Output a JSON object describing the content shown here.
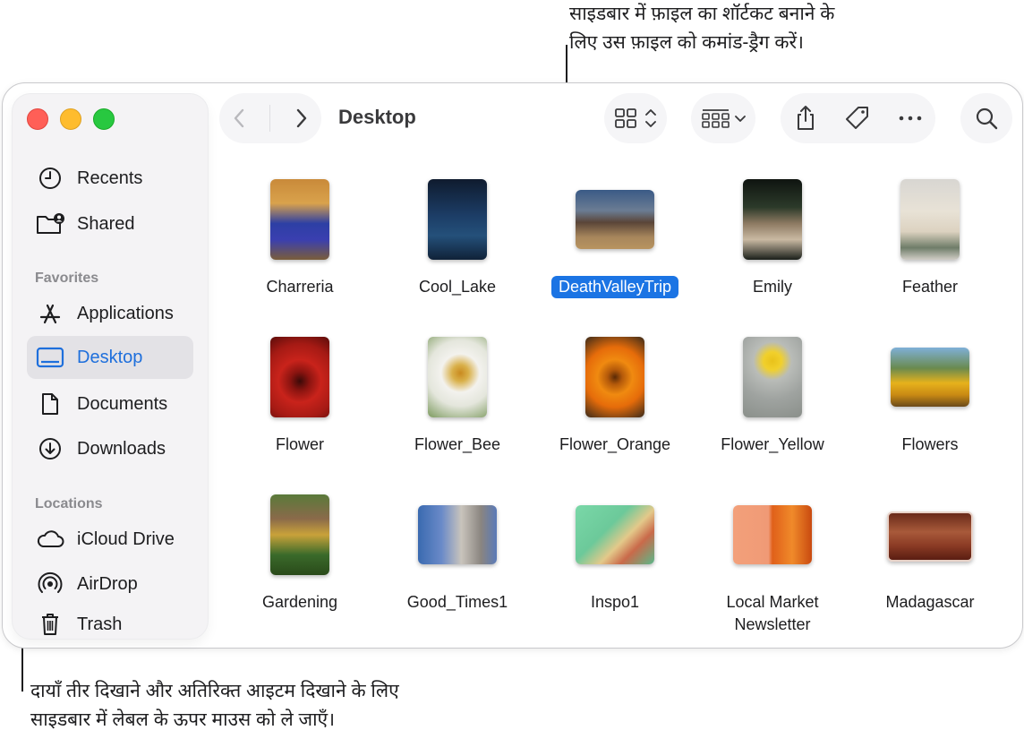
{
  "callouts": {
    "top": [
      "साइडबार में फ़ाइल का शॉर्टकट बनाने के",
      "लिए उस फ़ाइल को कमांड-ड्रैग करें।"
    ],
    "bottom": [
      "दायाँ तीर दिखाने और अतिरिक्त आइटम दिखाने के लिए",
      "साइडबार में लेबल के ऊपर माउस को ले जाएँ।"
    ]
  },
  "window": {
    "title": "Desktop"
  },
  "sidebar": {
    "items_top": [
      {
        "label": "Recents",
        "icon": "clock-icon"
      },
      {
        "label": "Shared",
        "icon": "shared-folder-icon"
      }
    ],
    "favorites_heading": "Favorites",
    "favorites": [
      {
        "label": "Applications",
        "icon": "applications-icon"
      },
      {
        "label": "Desktop",
        "icon": "desktop-icon",
        "selected": true
      },
      {
        "label": "Documents",
        "icon": "document-icon"
      },
      {
        "label": "Downloads",
        "icon": "download-icon"
      }
    ],
    "locations_heading": "Locations",
    "locations": [
      {
        "label": "iCloud Drive",
        "icon": "cloud-icon"
      },
      {
        "label": "AirDrop",
        "icon": "airdrop-icon"
      },
      {
        "label": "Trash",
        "icon": "trash-icon"
      }
    ]
  },
  "files": [
    {
      "name": "Charreria"
    },
    {
      "name": "Cool_Lake"
    },
    {
      "name": "DeathValleyTrip",
      "selected": true
    },
    {
      "name": "Emily"
    },
    {
      "name": "Feather"
    },
    {
      "name": "Flower"
    },
    {
      "name": "Flower_Bee"
    },
    {
      "name": "Flower_Orange"
    },
    {
      "name": "Flower_Yellow"
    },
    {
      "name": "Flowers"
    },
    {
      "name": "Gardening"
    },
    {
      "name": "Good_Times1"
    },
    {
      "name": "Inspo1"
    },
    {
      "name": "Local Market Newsletter",
      "lines": [
        "Local Market",
        "Newsletter"
      ]
    },
    {
      "name": "Madagascar"
    }
  ],
  "colors": {
    "accent": "#1b74e4",
    "sidebar_selected_text": "#1e6fdc"
  }
}
